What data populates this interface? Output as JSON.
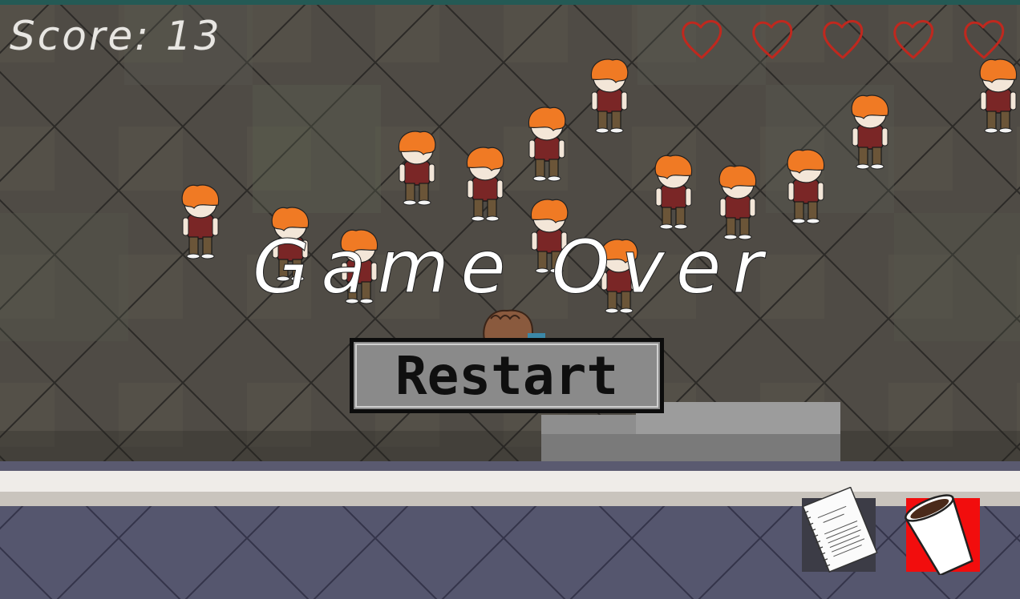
{
  "hud": {
    "score_text": "Score: 13",
    "lives_count": 5,
    "heart_icon": "heart-outline-icon",
    "heart_color": "#c0281e"
  },
  "overlay": {
    "title": "Game Over",
    "restart_label": "Restart"
  },
  "inventory": {
    "slots": [
      {
        "item": "document-icon",
        "background": "#3c3c46"
      },
      {
        "item": "coffee-cup-icon",
        "background": "#f20d0d"
      }
    ]
  },
  "colors": {
    "floor_upper": "#4e4a44",
    "floor_lower": "#55566e",
    "counter": "#efece8",
    "enemy_hair": "#f07a24",
    "enemy_shirt": "#7a2626",
    "enemy_pants": "#6b5538"
  }
}
